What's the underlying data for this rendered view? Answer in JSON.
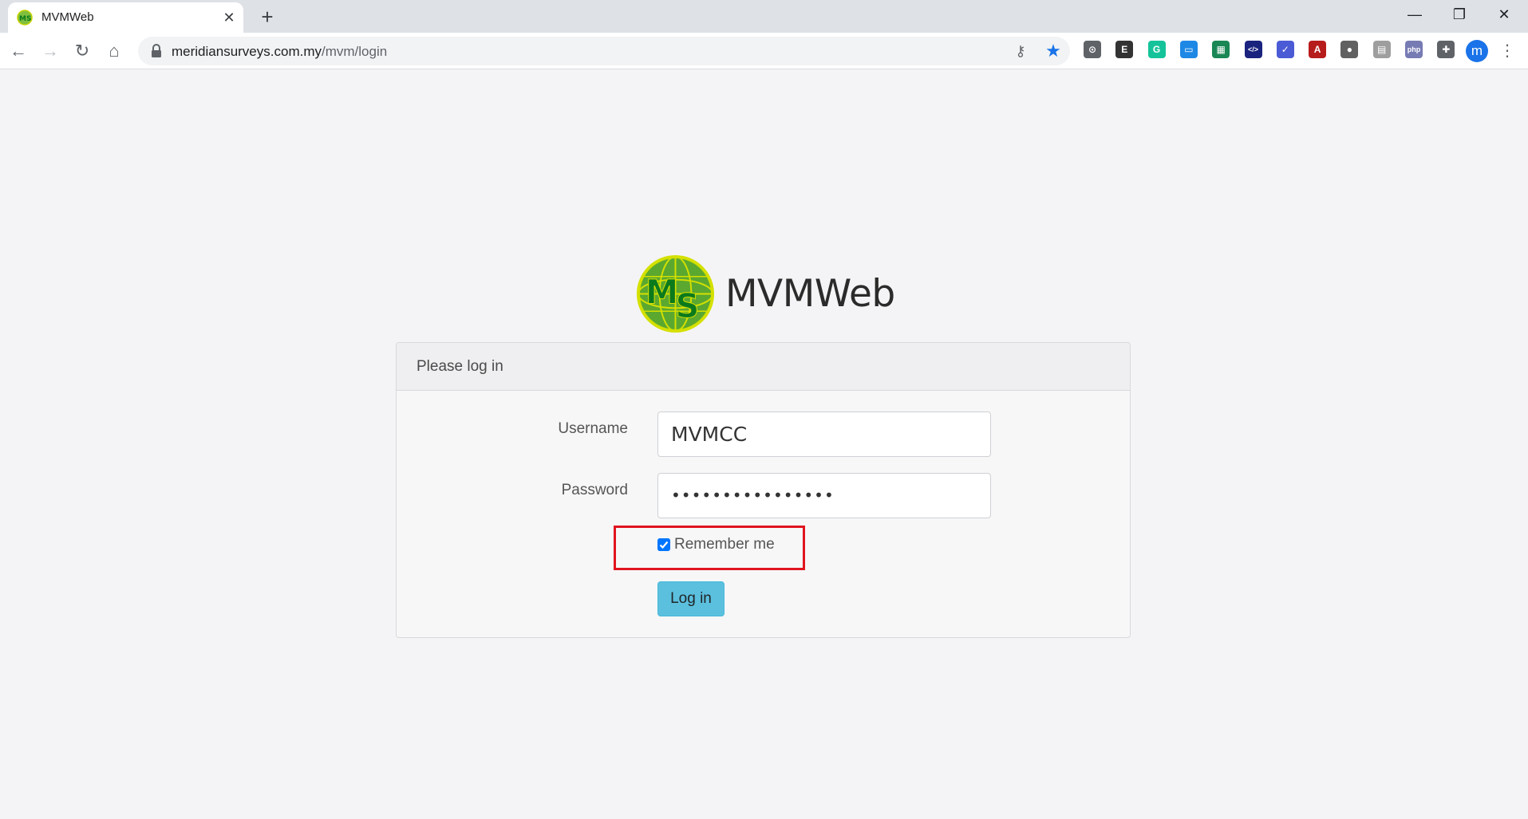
{
  "browser": {
    "tab_title": "MVMWeb",
    "tab_close": "✕",
    "new_tab": "+",
    "window": {
      "minimize": "—",
      "maximize": "❐",
      "close": "✕"
    },
    "nav": {
      "back": "←",
      "forward": "→",
      "reload": "↻",
      "home": "⌂"
    },
    "url_host": "meridiansurveys.com.my",
    "url_path": "/mvm/login",
    "omnibox_icons": [
      "key-icon",
      "star-icon"
    ],
    "extensions": [
      {
        "name": "extension-1-icon",
        "color": "#5f6368",
        "glyph": "⊙"
      },
      {
        "name": "extension-2-icon",
        "color": "#333333",
        "glyph": "E"
      },
      {
        "name": "grammarly-icon",
        "color": "#15c39a",
        "glyph": "G"
      },
      {
        "name": "extension-4-icon",
        "color": "#1e88e5",
        "glyph": "▭"
      },
      {
        "name": "extension-5-icon",
        "color": "#1a8754",
        "glyph": "▦"
      },
      {
        "name": "code-icon",
        "color": "#1a237e",
        "glyph": "</>"
      },
      {
        "name": "extension-7-icon",
        "color": "#4b5bd6",
        "glyph": "✓"
      },
      {
        "name": "acrobat-icon",
        "color": "#b71c1c",
        "glyph": "A"
      },
      {
        "name": "extension-9-icon",
        "color": "#616161",
        "glyph": "●"
      },
      {
        "name": "extension-10-icon",
        "color": "#9e9e9e",
        "glyph": "▤"
      },
      {
        "name": "php-icon",
        "color": "#777bb3",
        "glyph": "php"
      },
      {
        "name": "extensions-puzzle-icon",
        "color": "#5f6368",
        "glyph": "✚"
      }
    ],
    "profile_initial": "m",
    "menu": "⋮"
  },
  "page": {
    "brand_name": "MVMWeb",
    "card_title": "Please log in",
    "username_label": "Username",
    "username_value": "MVMCC",
    "password_label": "Password",
    "password_value": "••••••••••••••••",
    "remember_label": "Remember me",
    "remember_checked": true,
    "login_button": "Log in",
    "highlight_color": "#e0151f",
    "button_color": "#5bc0de"
  }
}
